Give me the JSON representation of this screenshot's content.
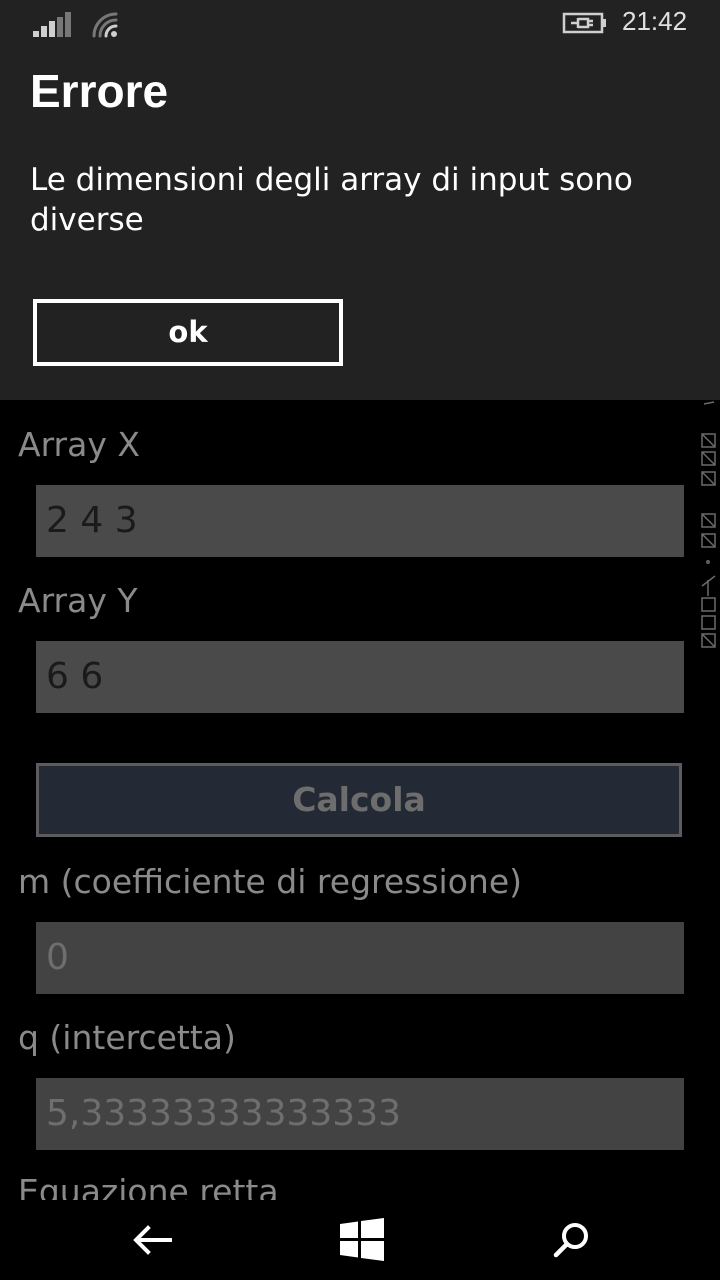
{
  "status_bar": {
    "time": "21:42",
    "icons": [
      "signal-icon",
      "wifi-icon",
      "battery-charging-icon"
    ]
  },
  "dialog": {
    "title": "Errore",
    "message": "Le dimensioni degli array di input sono diverse",
    "ok_label": "ok"
  },
  "form": {
    "array_x_label": "Array X",
    "array_x_value": "2 4 3",
    "array_y_label": "Array Y",
    "array_y_value": "6 6",
    "calc_label": "Calcola",
    "m_label": "m (coefficiente di regressione)",
    "m_value": "0",
    "q_label": "q (intercetta)",
    "q_value": "5,33333333333333",
    "eq_label": "Equazione retta"
  },
  "navbar": {
    "icons": [
      "back-icon",
      "windows-icon",
      "search-icon"
    ]
  },
  "colors": {
    "dialog_bg": "#222222",
    "app_bg": "#000000",
    "field_bg": "#4a4a4a",
    "button_bg": "#242a35"
  }
}
